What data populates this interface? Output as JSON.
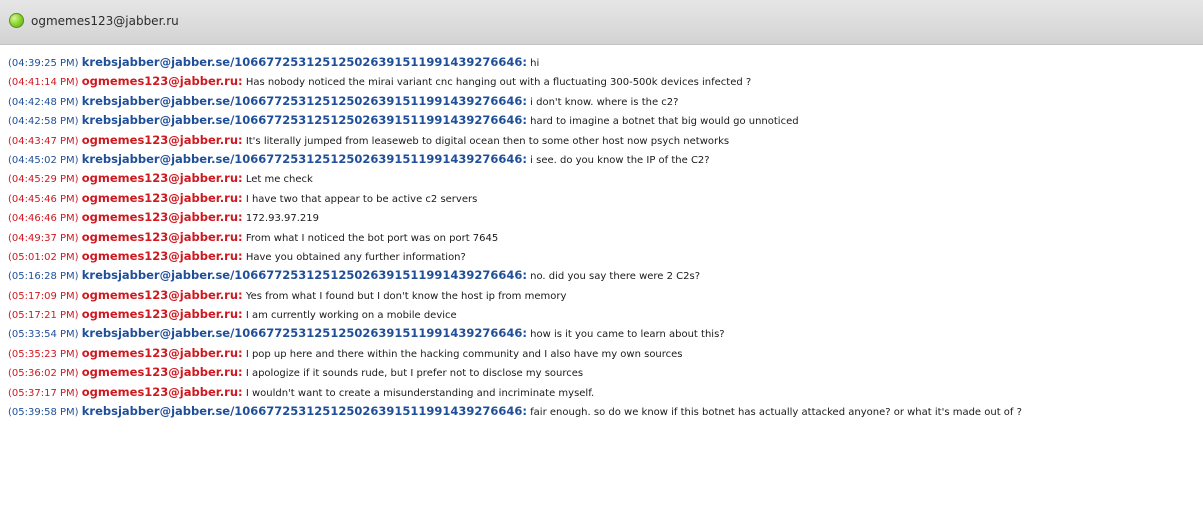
{
  "window": {
    "contact": "ogmemes123@jabber.ru",
    "status_color": "#7cc42a"
  },
  "colors": {
    "self": "#1f4f9a",
    "other": "#d0181f"
  },
  "messages": [
    {
      "time": "(04:39:25 PM)",
      "sender": "krebsjabber@jabber.se/106677253125125026391511991439276646:",
      "text": "hi",
      "color": "blue"
    },
    {
      "time": "(04:41:14 PM)",
      "sender": "ogmemes123@jabber.ru:",
      "text": "Has nobody noticed the mirai variant cnc hanging out with a fluctuating 300-500k devices infected ?",
      "color": "red"
    },
    {
      "time": "(04:42:48 PM)",
      "sender": "krebsjabber@jabber.se/106677253125125026391511991439276646:",
      "text": "i don't know. where is the c2?",
      "color": "blue"
    },
    {
      "time": "(04:42:58 PM)",
      "sender": "krebsjabber@jabber.se/106677253125125026391511991439276646:",
      "text": "hard to imagine a botnet that big would go unnoticed",
      "color": "blue"
    },
    {
      "time": "(04:43:47 PM)",
      "sender": "ogmemes123@jabber.ru:",
      "text": "It's literally jumped from leaseweb to digital ocean then to some other host now psych networks",
      "color": "red"
    },
    {
      "time": "(04:45:02 PM)",
      "sender": "krebsjabber@jabber.se/106677253125125026391511991439276646:",
      "text": "i see. do you know the IP of the C2?",
      "color": "blue"
    },
    {
      "time": "(04:45:29 PM)",
      "sender": "ogmemes123@jabber.ru:",
      "text": "Let me check",
      "color": "red"
    },
    {
      "time": "(04:45:46 PM)",
      "sender": "ogmemes123@jabber.ru:",
      "text": "I have two that appear to be active c2  servers",
      "color": "red"
    },
    {
      "time": "(04:46:46 PM)",
      "sender": "ogmemes123@jabber.ru:",
      "text": "172.93.97.219",
      "color": "red"
    },
    {
      "time": "(04:49:37 PM)",
      "sender": "ogmemes123@jabber.ru:",
      "text": "From what I noticed the bot port was on port 7645",
      "color": "red"
    },
    {
      "time": "(05:01:02 PM)",
      "sender": "ogmemes123@jabber.ru:",
      "text": "Have you obtained any further information?",
      "color": "red"
    },
    {
      "time": "(05:16:28 PM)",
      "sender": "krebsjabber@jabber.se/106677253125125026391511991439276646:",
      "text": "no. did you say there were 2 C2s?",
      "color": "blue"
    },
    {
      "time": "(05:17:09 PM)",
      "sender": "ogmemes123@jabber.ru:",
      "text": "Yes from what I found but I don't know the host ip from memory",
      "color": "red"
    },
    {
      "time": "(05:17:21 PM)",
      "sender": "ogmemes123@jabber.ru:",
      "text": "I am currently working on a mobile device",
      "color": "red"
    },
    {
      "time": "(05:33:54 PM)",
      "sender": "krebsjabber@jabber.se/106677253125125026391511991439276646:",
      "text": "how is it you came to learn about this?",
      "color": "blue"
    },
    {
      "time": "(05:35:23 PM)",
      "sender": "ogmemes123@jabber.ru:",
      "text": "I pop up here and there within the hacking community and I also have my own sources",
      "color": "red"
    },
    {
      "time": "(05:36:02 PM)",
      "sender": "ogmemes123@jabber.ru:",
      "text": "I apologize if it sounds rude, but I prefer not to disclose my sources",
      "color": "red"
    },
    {
      "time": "(05:37:17 PM)",
      "sender": "ogmemes123@jabber.ru:",
      "text": "I wouldn't want to create a misunderstanding and incriminate myself.",
      "color": "red"
    },
    {
      "time": "(05:39:58 PM)",
      "sender": "krebsjabber@jabber.se/106677253125125026391511991439276646:",
      "text": "fair enough. so do we know if this botnet has actually attacked anyone? or what it's made out of ?",
      "color": "blue"
    }
  ]
}
